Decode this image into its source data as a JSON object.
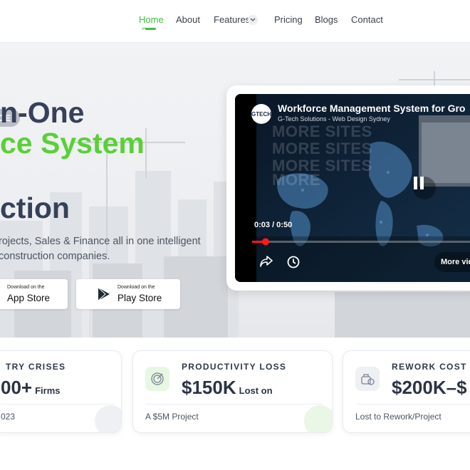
{
  "nav": {
    "items": [
      {
        "label": "Home"
      },
      {
        "label": "About"
      },
      {
        "label": "Features"
      },
      {
        "label": "Pricing"
      },
      {
        "label": "Blogs"
      },
      {
        "label": "Contact"
      }
    ],
    "active_color": "#3fbf3a"
  },
  "hero": {
    "badge": "CE",
    "title_line1": "n-One",
    "title_line2": "ce System",
    "title_line3": "ction",
    "subtitle_line1": "rojects, Sales & Finance all in one intelligent",
    "subtitle_line2": "construction companies.",
    "app_store": {
      "small": "Download on the",
      "big": "App Store"
    },
    "play_store": {
      "small": "Download on the",
      "big": "Play Store"
    },
    "colors": {
      "title_dark": "#364059",
      "title_green": "#5ad036"
    }
  },
  "video": {
    "title": "Workforce Management System for Gro",
    "channel": "G-Tech Solutions - Web Design Sydney",
    "logo_text": "GTECH",
    "watermark": [
      "MORE SITES",
      "MORE SITES",
      "MORE SITES",
      "MORE"
    ],
    "time": "0:03 / 0:50",
    "progress": 0.06,
    "more_label": "More vid",
    "icons": [
      "pause-icon",
      "share-icon",
      "clock-icon"
    ]
  },
  "stats": [
    {
      "label": "TRY CRISES",
      "value": "00+",
      "unit": "Firms",
      "foot": "023"
    },
    {
      "label": "PRODUCTIVITY LOSS",
      "value": "$150K",
      "unit": "Lost on",
      "foot": "A $5M Project"
    },
    {
      "label": "REWORK COST",
      "value": "$200K–$",
      "unit": "",
      "foot": "Lost to Rework/Project"
    }
  ]
}
